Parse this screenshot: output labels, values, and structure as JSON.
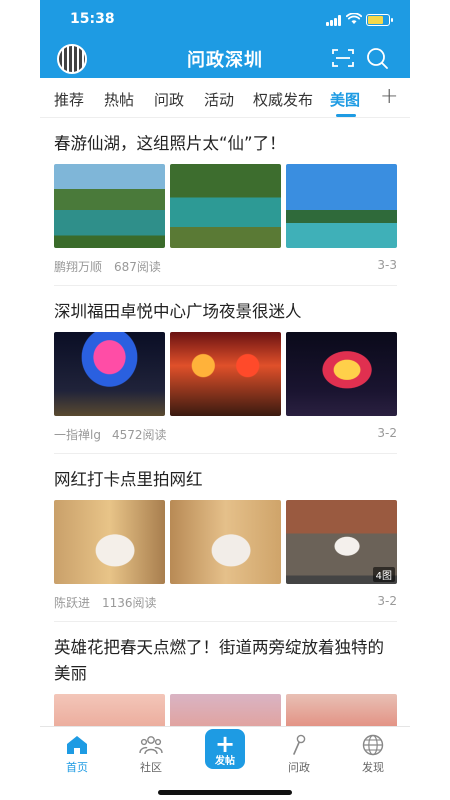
{
  "status_bar": {
    "time": "15:38"
  },
  "app_bar": {
    "title": "问政深圳"
  },
  "tabs": [
    {
      "label": "推荐"
    },
    {
      "label": "热帖"
    },
    {
      "label": "问政"
    },
    {
      "label": "活动"
    },
    {
      "label": "权威发布"
    },
    {
      "label": "美图"
    }
  ],
  "active_tab": "美图",
  "articles": [
    {
      "title": "春游仙湖，这组照片太“仙”了！",
      "author": "鹏翔万顺",
      "reads": "687阅读",
      "date": "3-3",
      "images": [
        "lake-photo",
        "lake-photo",
        "lake-photo"
      ]
    },
    {
      "title": "深圳福田卓悦中心广场夜景很迷人",
      "author": "一指禅lg",
      "reads": "4572阅读",
      "date": "3-2",
      "images": [
        "night-photo",
        "night-photo",
        "night-photo"
      ]
    },
    {
      "title": "网红打卡点里拍网红",
      "author": "陈跃进",
      "reads": "1136阅读",
      "date": "3-2",
      "image_count_badge": "4图",
      "images": [
        "portrait-photo",
        "portrait-photo",
        "portrait-photo"
      ]
    },
    {
      "title": "英雄花把春天点燃了！街道两旁绽放着独特的美丽",
      "images": [
        "flower-photo",
        "flower-photo",
        "flower-photo"
      ]
    }
  ],
  "bottom_nav": [
    {
      "label": "首页",
      "icon": "home-icon",
      "active": true
    },
    {
      "label": "社区",
      "icon": "community-icon"
    },
    {
      "label": "发帖",
      "icon": "plus-icon"
    },
    {
      "label": "问政",
      "icon": "microphone-icon"
    },
    {
      "label": "发现",
      "icon": "globe-icon"
    }
  ],
  "colors": {
    "brand": "#1e9be3",
    "text": "#222222",
    "meta": "#999999"
  }
}
